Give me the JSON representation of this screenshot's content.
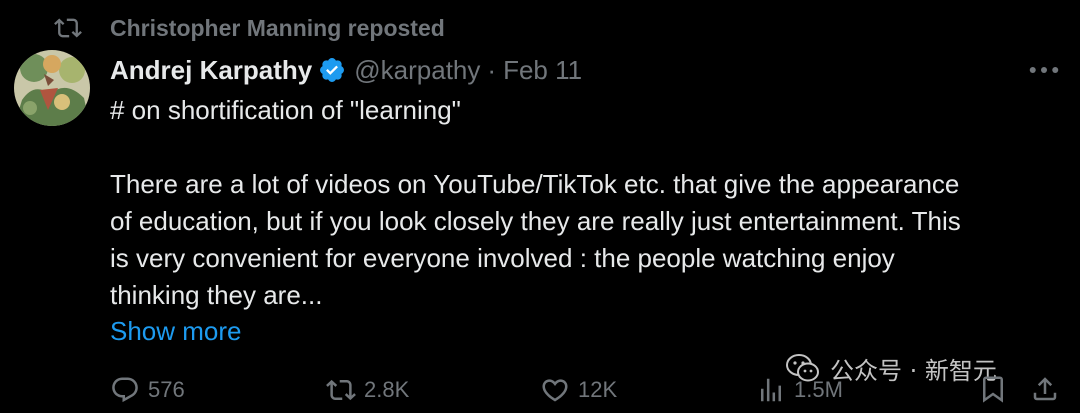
{
  "repost": {
    "text": "Christopher Manning reposted",
    "icon": "repost-icon"
  },
  "author": {
    "name": "Andrej Karpathy",
    "verified_icon": "verified-badge-icon",
    "handle": "@karpathy",
    "separator": "·",
    "date": "Feb 11"
  },
  "tweet": {
    "line1": "# on shortification of \"learning\"",
    "lines": [
      "There are a lot of videos on YouTube/TikTok etc. that give the appearance",
      "of education, but if you look closely they are really just entertainment. This",
      "is very convenient for everyone involved : the people watching enjoy",
      "thinking they are..."
    ],
    "show_more": "Show more"
  },
  "actions": {
    "replies": "576",
    "reposts": "2.8K",
    "likes": "12K",
    "views": "1.5M"
  },
  "watermark": {
    "text": "公众号 · 新智元",
    "icon": "wechat-icon"
  },
  "colors": {
    "background": "#000000",
    "text": "#e7e9ea",
    "muted": "#71767b",
    "link": "#1d9bf0",
    "verified": "#1d9bf0"
  }
}
